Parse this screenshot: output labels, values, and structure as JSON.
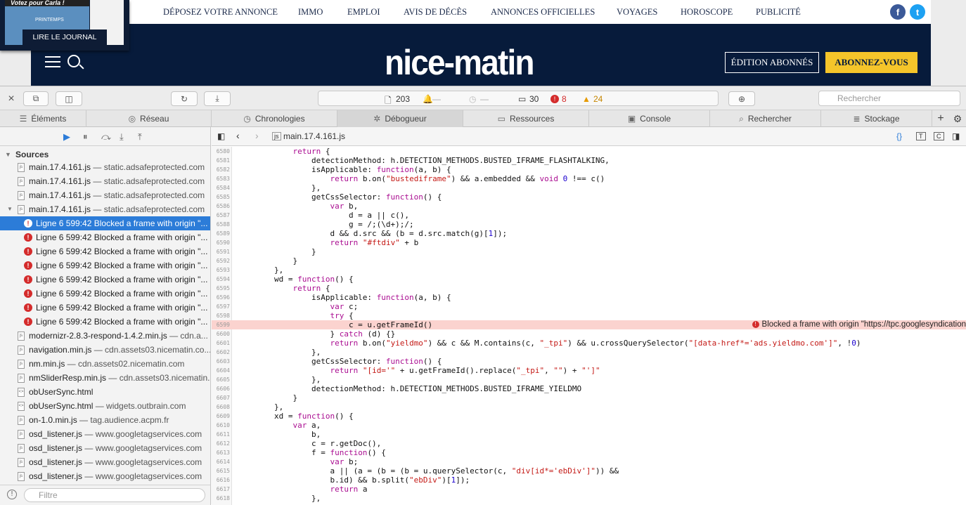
{
  "site": {
    "nav": [
      "DÉPOSEZ VOTRE ANNONCE",
      "IMMO",
      "EMPLOI",
      "AVIS DE DÉCÈS",
      "ANNONCES OFFICIELLES",
      "VOYAGES",
      "HOROSCOPE",
      "PUBLICITÉ"
    ],
    "logo": "nice-matin",
    "edition_button": "ÉDITION ABONNÉS",
    "subscribe_button": "ABONNEZ-VOUS",
    "journal_button": "LIRE LE JOURNAL",
    "journal_vote": "Votez pour Carla !",
    "journal_spring": "PRINTEMPS",
    "brand_colors": {
      "navy": "#071b3b",
      "yellow": "#f5c52a",
      "facebook": "#3b5998",
      "twitter": "#1da1f2"
    }
  },
  "devtools": {
    "resource_count": "203",
    "dash1": "—",
    "dash2": "—",
    "log_count": "30",
    "error_count": "8",
    "warning_count": "24",
    "search_placeholder": "Rechercher",
    "tabs": [
      "Éléments",
      "Réseau",
      "Chronologies",
      "Débogueur",
      "Ressources",
      "Console",
      "Rechercher",
      "Stockage"
    ],
    "active_tab": "Débogueur",
    "sources_header": "Sources",
    "filter_placeholder": "Filtre",
    "current_file": "main.17.4.161.js",
    "sources": [
      {
        "name": "main.17.4.161.js",
        "host": " — static.adsafeprotected.com",
        "type": "file"
      },
      {
        "name": "main.17.4.161.js",
        "host": " — static.adsafeprotected.com",
        "type": "file"
      },
      {
        "name": "main.17.4.161.js",
        "host": " — static.adsafeprotected.com",
        "type": "file"
      },
      {
        "name": "main.17.4.161.js",
        "host": " — static.adsafeprotected.com",
        "type": "file-open"
      },
      {
        "name": "Ligne 6 599:42 Blocked a frame with origin \"...",
        "type": "error",
        "selected": true
      },
      {
        "name": "Ligne 6 599:42 Blocked a frame with origin \"...",
        "type": "error"
      },
      {
        "name": "Ligne 6 599:42 Blocked a frame with origin \"...",
        "type": "error"
      },
      {
        "name": "Ligne 6 599:42 Blocked a frame with origin \"...",
        "type": "error"
      },
      {
        "name": "Ligne 6 599:42 Blocked a frame with origin \"...",
        "type": "error"
      },
      {
        "name": "Ligne 6 599:42 Blocked a frame with origin \"...",
        "type": "error"
      },
      {
        "name": "Ligne 6 599:42 Blocked a frame with origin \"...",
        "type": "error"
      },
      {
        "name": "Ligne 6 599:42 Blocked a frame with origin \"...",
        "type": "error"
      },
      {
        "name": "modernizr-2.8.3-respond-1.4.2.min.js",
        "host": " — cdn.a...",
        "type": "file"
      },
      {
        "name": "navigation.min.js",
        "host": " — cdn.assets03.nicematin.co...",
        "type": "file"
      },
      {
        "name": "nm.min.js",
        "host": " — cdn.assets02.nicematin.com",
        "type": "file"
      },
      {
        "name": "nmSliderResp.min.js",
        "host": " — cdn.assets03.nicematin...",
        "type": "file"
      },
      {
        "name": "obUserSync.html",
        "host": "",
        "type": "html"
      },
      {
        "name": "obUserSync.html",
        "host": " — widgets.outbrain.com",
        "type": "html"
      },
      {
        "name": "on-1.0.min.js",
        "host": " — tag.audience.acpm.fr",
        "type": "file"
      },
      {
        "name": "osd_listener.js",
        "host": " — www.googletagservices.com",
        "type": "file"
      },
      {
        "name": "osd_listener.js",
        "host": " — www.googletagservices.com",
        "type": "file"
      },
      {
        "name": "osd_listener.js",
        "host": " — www.googletagservices.com",
        "type": "file"
      },
      {
        "name": "osd_listener.js",
        "host": " — www.googletagservices.com",
        "type": "file"
      }
    ],
    "error_message": "Blocked a frame with origin \"https://tpc.googlesyndication",
    "code": [
      {
        "n": "6580",
        "t": "            return {"
      },
      {
        "n": "6581",
        "t": "                detectionMethod: h.DETECTION_METHODS.BUSTED_IFRAME_FLASHTALKING,"
      },
      {
        "n": "6582",
        "t": "                isApplicable: function(a, b) {"
      },
      {
        "n": "6583",
        "t": "                    return b.on(\"bustediframe\") && a.embedded && void 0 !== c()"
      },
      {
        "n": "6584",
        "t": "                },"
      },
      {
        "n": "6585",
        "t": "                getCssSelector: function() {"
      },
      {
        "n": "6586",
        "t": "                    var b,"
      },
      {
        "n": "6587",
        "t": "                        d = a || c(),"
      },
      {
        "n": "6588",
        "t": "                        g = /;(\\d+);/;"
      },
      {
        "n": "6589",
        "t": "                    d && d.src && (b = d.src.match(g)[1]);"
      },
      {
        "n": "6590",
        "t": "                    return \"#ftdiv\" + b"
      },
      {
        "n": "6591",
        "t": "                }"
      },
      {
        "n": "6592",
        "t": "            }"
      },
      {
        "n": "6593",
        "t": "        },"
      },
      {
        "n": "6594",
        "t": "        wd = function() {"
      },
      {
        "n": "6595",
        "t": "            return {"
      },
      {
        "n": "6596",
        "t": "                isApplicable: function(a, b) {"
      },
      {
        "n": "6597",
        "t": "                    var c;"
      },
      {
        "n": "6598",
        "t": "                    try {"
      },
      {
        "n": "6599",
        "t": "                        c = u.getFrameId()",
        "err": true
      },
      {
        "n": "6600",
        "t": "                    } catch (d) {}"
      },
      {
        "n": "6601",
        "t": "                    return b.on(\"yieldmo\") && c && M.contains(c, \"_tpi\") && u.crossQuerySelector(\"[data-href*='ads.yieldmo.com']\", !0)"
      },
      {
        "n": "6602",
        "t": "                },"
      },
      {
        "n": "6603",
        "t": "                getCssSelector: function() {"
      },
      {
        "n": "6604",
        "t": "                    return \"[id='\" + u.getFrameId().replace(\"_tpi\", \"\") + \"']\""
      },
      {
        "n": "6605",
        "t": "                },"
      },
      {
        "n": "6606",
        "t": "                detectionMethod: h.DETECTION_METHODS.BUSTED_IFRAME_YIELDMO"
      },
      {
        "n": "6607",
        "t": "            }"
      },
      {
        "n": "6608",
        "t": "        },"
      },
      {
        "n": "6609",
        "t": "        xd = function() {"
      },
      {
        "n": "6610",
        "t": "            var a,"
      },
      {
        "n": "6611",
        "t": "                b,"
      },
      {
        "n": "6612",
        "t": "                c = r.getDoc(),"
      },
      {
        "n": "6613",
        "t": "                f = function() {"
      },
      {
        "n": "6614",
        "t": "                    var b;"
      },
      {
        "n": "6615",
        "t": "                    a || (a = (b = (b = u.querySelector(c, \"div[id*='ebDiv']\")) &&"
      },
      {
        "n": "6616",
        "t": "                    b.id) && b.split(\"ebDiv\")[1]);"
      },
      {
        "n": "6617",
        "t": "                    return a"
      },
      {
        "n": "6618",
        "t": "                },"
      }
    ]
  }
}
